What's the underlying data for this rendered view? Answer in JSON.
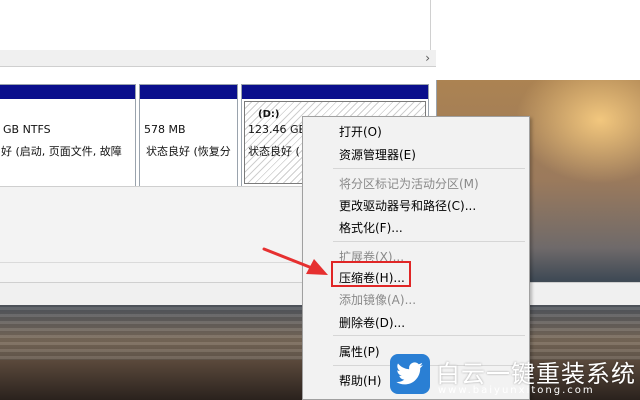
{
  "disk_partitions": [
    {
      "size": "GB NTFS",
      "status": "好 (启动, 页面文件, 故障"
    },
    {
      "size": "578 MB",
      "status": "状态良好 (恢复分"
    },
    {
      "name": "(D:)",
      "size": "123.46 GB",
      "status": "状态良好 ("
    }
  ],
  "context_menu": {
    "items": [
      {
        "label": "打开(O)",
        "enabled": true
      },
      {
        "label": "资源管理器(E)",
        "enabled": true
      },
      {
        "label": "将分区标记为活动分区(M)",
        "enabled": false
      },
      {
        "label": "更改驱动器号和路径(C)...",
        "enabled": true
      },
      {
        "label": "格式化(F)...",
        "enabled": true
      },
      {
        "label": "扩展卷(X)...",
        "enabled": false
      },
      {
        "label": "压缩卷(H)...",
        "enabled": true,
        "highlighted": true
      },
      {
        "label": "添加镜像(A)...",
        "enabled": false
      },
      {
        "label": "删除卷(D)...",
        "enabled": true
      },
      {
        "label": "属性(P)",
        "enabled": true
      },
      {
        "label": "帮助(H)",
        "enabled": true
      }
    ]
  },
  "watermark": {
    "title": "白云一键重装系统",
    "url": "www.baiyunxitong.com",
    "logo_icon": "twitter-bird-icon"
  },
  "colors": {
    "partition_bar": "#0a0f8c",
    "highlight": "#e02626",
    "watermark_logo": "#2a7fd4"
  }
}
